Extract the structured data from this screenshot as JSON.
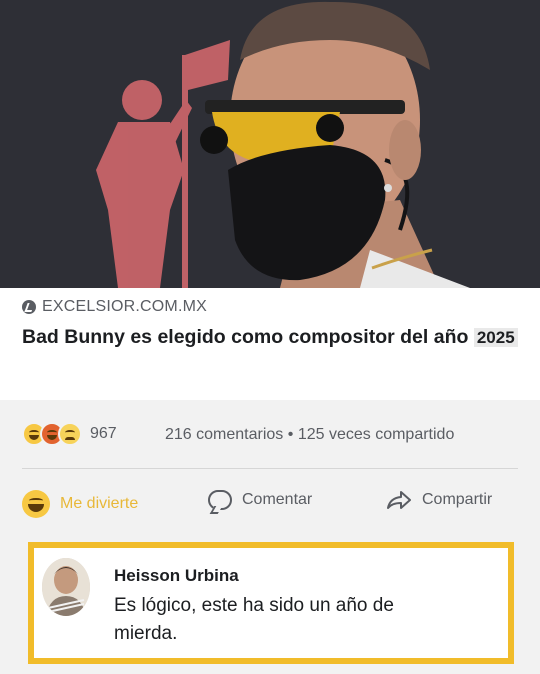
{
  "post": {
    "source": "EXCELSIOR.COM.MX",
    "headline_main": "Bad Bunny es elegido como compositor del año",
    "headline_year": "2025"
  },
  "stats": {
    "reaction_count": "967",
    "comments_text": "216 comentarios",
    "separator": "•",
    "shares_text": "125 veces compartido"
  },
  "actions": {
    "reaction_label": "Me divierte",
    "comment_label": "Comentar",
    "share_label": "Compartir"
  },
  "comment": {
    "author": "Heisson Urbina",
    "text": "Es lógico, este ha sido un año  de mierda."
  },
  "colors": {
    "highlight": "#f1bc2a",
    "haha": "#e8b838",
    "muted": "#5a5d63"
  }
}
